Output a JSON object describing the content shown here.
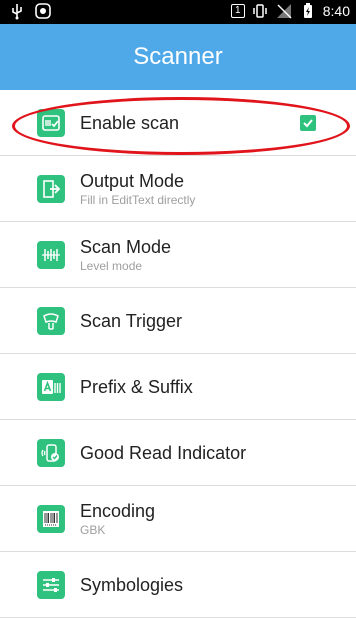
{
  "status_bar": {
    "time": "8:40",
    "sim_badge": "1",
    "icons": [
      "usb-icon",
      "android-debug-icon",
      "vibrate-icon",
      "no-signal-icon",
      "battery-charging-icon"
    ]
  },
  "appbar": {
    "title": "Scanner"
  },
  "settings": [
    {
      "label": "Enable scan",
      "summary": "",
      "icon": "scanner-check-icon",
      "checked": true
    },
    {
      "label": "Output Mode",
      "summary": "Fill in EditText directly",
      "icon": "output-arrow-icon"
    },
    {
      "label": "Scan Mode",
      "summary": "Level mode",
      "icon": "barcode-scan-icon"
    },
    {
      "label": "Scan Trigger",
      "summary": "",
      "icon": "trigger-button-icon"
    },
    {
      "label": "Prefix & Suffix",
      "summary": "",
      "icon": "prefix-suffix-icon"
    },
    {
      "label": "Good Read Indicator",
      "summary": "",
      "icon": "read-indicator-icon"
    },
    {
      "label": "Encoding",
      "summary": "GBK",
      "icon": "barcode-encoding-icon"
    },
    {
      "label": "Symbologies",
      "summary": "",
      "icon": "symbologies-sliders-icon"
    }
  ],
  "colors": {
    "appbar": "#4fa9e9",
    "icon_green": "#2ec27e",
    "highlight_red": "#e0141a"
  }
}
